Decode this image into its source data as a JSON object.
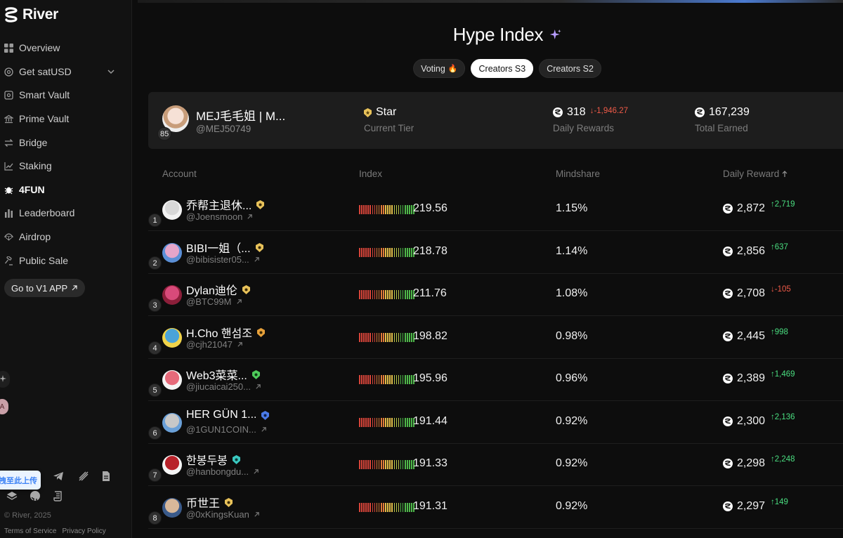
{
  "brand": {
    "name": "River"
  },
  "sidebar": {
    "items": [
      {
        "label": "Overview",
        "icon": "grid-icon"
      },
      {
        "label": "Get satUSD",
        "icon": "circle-dollar-icon",
        "has_chevron": true
      },
      {
        "label": "Smart Vault",
        "icon": "vault-icon"
      },
      {
        "label": "Prime Vault",
        "icon": "bank-icon"
      },
      {
        "label": "Bridge",
        "icon": "swap-arrows-icon"
      },
      {
        "label": "Staking",
        "icon": "chart-line-icon"
      },
      {
        "label": "4FUN",
        "icon": "bug-icon",
        "active": true
      },
      {
        "label": "Leaderboard",
        "icon": "bars-icon"
      },
      {
        "label": "Airdrop",
        "icon": "parachute-icon"
      },
      {
        "label": "Public Sale",
        "icon": "gavel-icon"
      }
    ],
    "v1_button": "Go to V1 APP",
    "upload_tip": "拽至此上传",
    "copyright": "© River, 2025",
    "terms": "Terms of Service",
    "privacy": "Privacy Policy",
    "side_avatar_letter": "A"
  },
  "header": {
    "title": "Hype Index",
    "tabs": [
      {
        "label": "Voting",
        "emoji": "🔥",
        "active": false
      },
      {
        "label": "Creators S3",
        "active": true
      },
      {
        "label": "Creators S2",
        "active": false
      }
    ]
  },
  "me": {
    "name": "MEJ毛毛姐 | M...",
    "handle": "@MEJ50749",
    "rank": "85",
    "tier": "Star",
    "tier_label": "Current Tier",
    "daily_rewards": "318",
    "daily_rewards_delta": "↓-1,946.27",
    "daily_rewards_label": "Daily Rewards",
    "total_earned": "167,239",
    "total_earned_label": "Total Earned"
  },
  "table": {
    "columns": {
      "account": "Account",
      "index": "Index",
      "mindshare": "Mindshare",
      "daily_reward": "Daily Reward"
    },
    "rows": [
      {
        "rank": "1",
        "name": "乔帮主退休...",
        "handle": "@Joensmoon",
        "index": "219.56",
        "mindshare": "1.15%",
        "reward": "2,872",
        "delta": "↑2,719",
        "up": true,
        "tier_color": "#e8c25a",
        "avatar_colors": [
          "#f2f2f2",
          "#d8d8d8"
        ]
      },
      {
        "rank": "2",
        "name": "BIBI一姐（...",
        "handle": "@bibisister05...",
        "index": "218.78",
        "mindshare": "1.14%",
        "reward": "2,856",
        "delta": "↑637",
        "up": true,
        "tier_color": "#e8c25a",
        "avatar_colors": [
          "#5b8fd6",
          "#e6a5c9"
        ]
      },
      {
        "rank": "3",
        "name": "Dylan迪伦",
        "handle": "@BTC99M",
        "index": "211.76",
        "mindshare": "1.08%",
        "reward": "2,708",
        "delta": "↓-105",
        "up": false,
        "tier_color": "#e8c25a",
        "avatar_colors": [
          "#8c1f3a",
          "#d84a7a"
        ]
      },
      {
        "rank": "4",
        "name": "H.Cho 핸섬조",
        "handle": "@cjh21047",
        "index": "198.82",
        "mindshare": "0.98%",
        "reward": "2,445",
        "delta": "↑998",
        "up": true,
        "tier_color": "#e8a13a",
        "avatar_colors": [
          "#f0d34a",
          "#4aa3d9"
        ]
      },
      {
        "rank": "5",
        "name": "Web3菜菜...",
        "handle": "@jiucaicai250...",
        "index": "195.96",
        "mindshare": "0.96%",
        "reward": "2,389",
        "delta": "↑1,469",
        "up": true,
        "tier_color": "#4ecb5a",
        "avatar_colors": [
          "#f4f4f4",
          "#e66a7a"
        ]
      },
      {
        "rank": "6",
        "name": "HER GÜN 1...",
        "handle": "@1GUN1COIN...",
        "index": "191.44",
        "mindshare": "0.92%",
        "reward": "2,300",
        "delta": "↑2,136",
        "up": true,
        "tier_color": "#4a7ae8",
        "avatar_colors": [
          "#6aa0d8",
          "#c8c8c8"
        ]
      },
      {
        "rank": "7",
        "name": "한봉두봉",
        "handle": "@hanbongdu...",
        "index": "191.33",
        "mindshare": "0.92%",
        "reward": "2,298",
        "delta": "↑2,248",
        "up": true,
        "tier_color": "#3ac9c0",
        "avatar_colors": [
          "#f4f4f4",
          "#b8222a"
        ]
      },
      {
        "rank": "8",
        "name": "币世王",
        "handle": "@0xKingsKuan",
        "index": "191.31",
        "mindshare": "0.92%",
        "reward": "2,297",
        "delta": "↑149",
        "up": true,
        "tier_color": "#e8c25a",
        "avatar_colors": [
          "#3a5a8a",
          "#d8b89a"
        ]
      }
    ]
  },
  "colors": {
    "up": "#4ade80",
    "down": "#ef5a48",
    "accent": "#b79cff"
  }
}
